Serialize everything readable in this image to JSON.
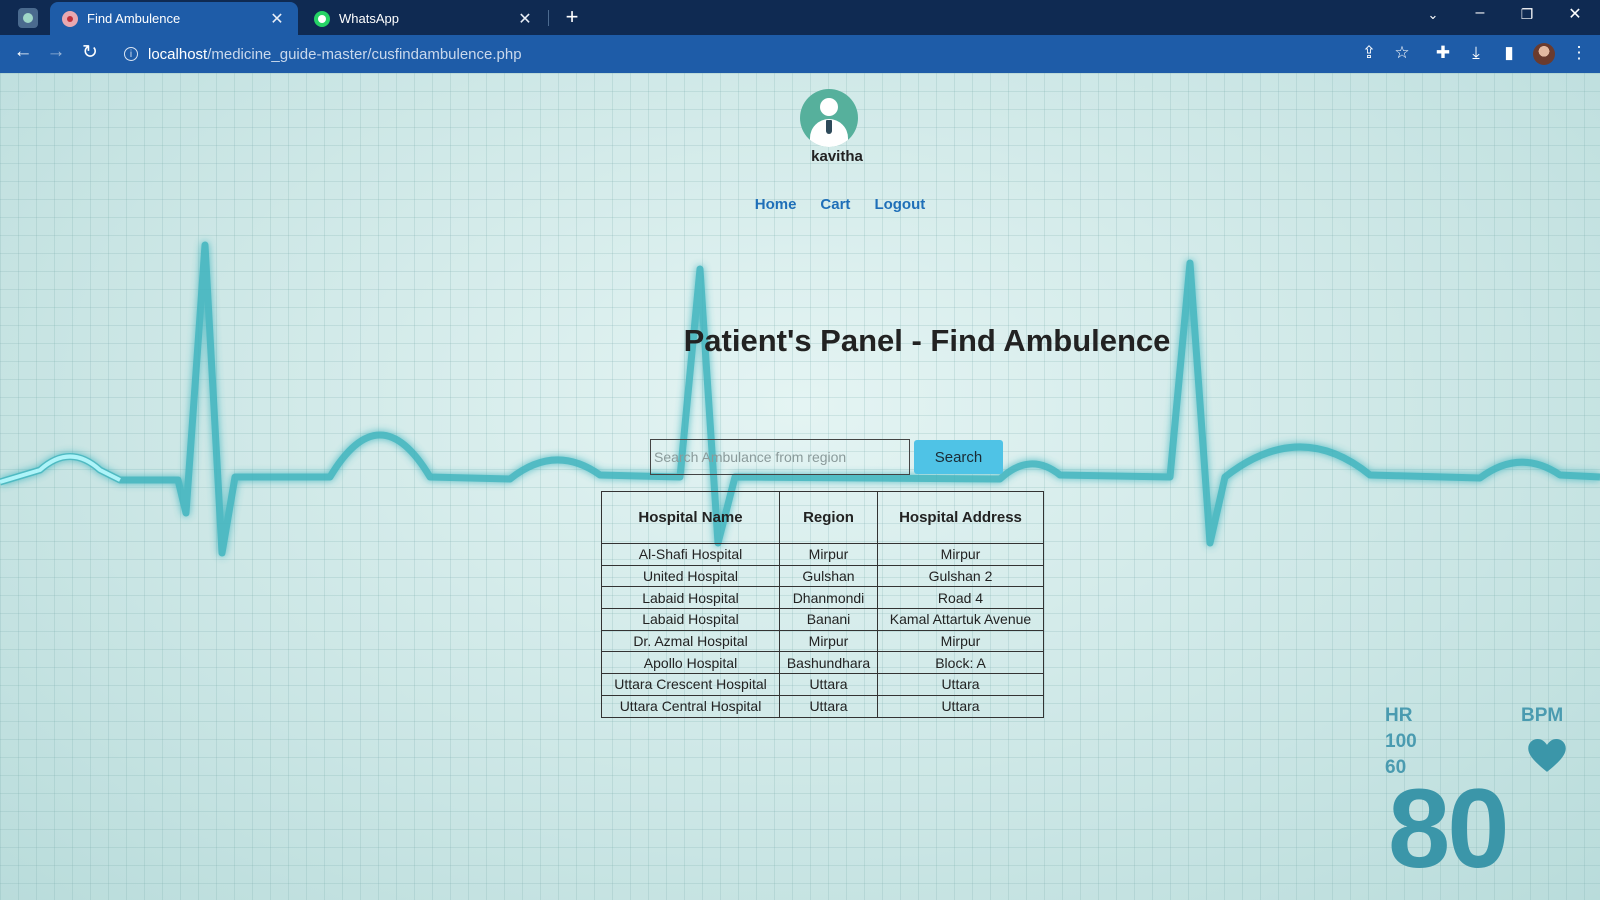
{
  "browser": {
    "tabs": [
      {
        "title": "Find Ambulence",
        "active": true,
        "icon": "ambulance-favicon-icon"
      },
      {
        "title": "WhatsApp",
        "active": false,
        "icon": "whatsapp-icon"
      }
    ],
    "url_host": "localhost",
    "url_path": "/medicine_guide-master/cusfindambulence.php",
    "colors": {
      "tabstrip": "#0f2a52",
      "toolbar": "#1e5ca8"
    }
  },
  "header": {
    "username": "kavitha",
    "nav": [
      {
        "label": "Home"
      },
      {
        "label": "Cart"
      },
      {
        "label": "Logout"
      }
    ]
  },
  "main": {
    "title": "Patient's Panel - Find Ambulence",
    "search": {
      "placeholder": "Search Ambulance from region",
      "value": "",
      "button_label": "Search"
    },
    "table": {
      "columns": [
        "Hospital Name",
        "Region",
        "Hospital Address"
      ],
      "rows": [
        [
          "Al-Shafi Hospital",
          "Mirpur",
          "Mirpur"
        ],
        [
          "United Hospital",
          "Gulshan",
          "Gulshan 2"
        ],
        [
          "Labaid Hospital",
          "Dhanmondi",
          "Road 4"
        ],
        [
          "Labaid Hospital",
          "Banani",
          "Kamal Attartuk Avenue"
        ],
        [
          "Dr. Azmal Hospital",
          "Mirpur",
          "Mirpur"
        ],
        [
          "Apollo Hospital",
          "Bashundhara",
          "Block: A"
        ],
        [
          "Uttara Crescent Hospital",
          "Uttara",
          "Uttara"
        ],
        [
          "Uttara Central Hospital",
          "Uttara",
          "Uttara"
        ]
      ]
    }
  },
  "background_monitor": {
    "hr_label": "HR",
    "bpm_label": "BPM",
    "upper_limit": "100",
    "lower_limit": "60",
    "reading": "80",
    "accent_color": "#3b96a9"
  }
}
